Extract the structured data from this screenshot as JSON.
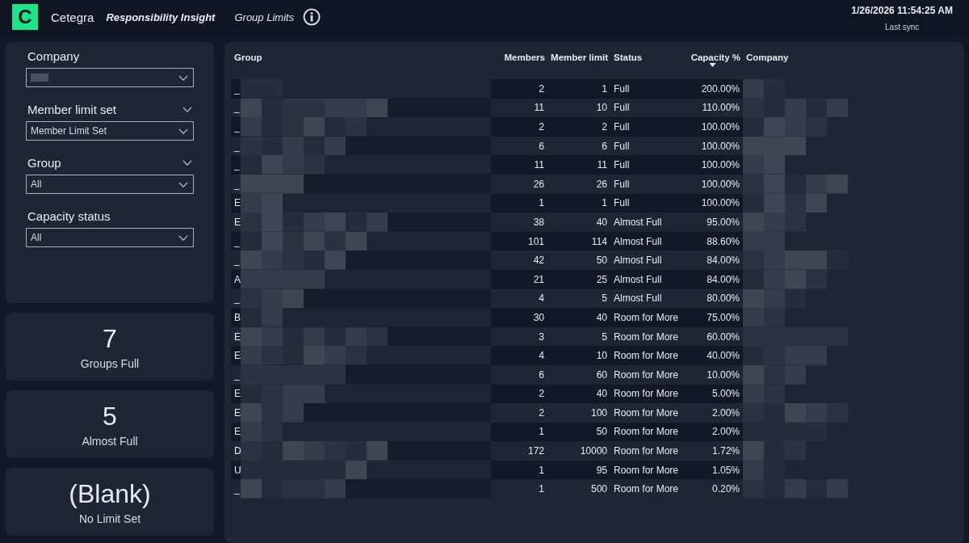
{
  "header": {
    "logo": "C",
    "brand": "Cetegra",
    "app_title": "Responsibility Insight",
    "page_title": "Group Limits",
    "sync_time": "1/26/2026 11:54:25 AM",
    "sync_label": "Last sync"
  },
  "filters": [
    {
      "label": "Company",
      "collapsible": false,
      "value_redacted": true
    },
    {
      "label": "Member limit set",
      "collapsible": true,
      "value": "Member Limit Set"
    },
    {
      "label": "Group",
      "collapsible": true,
      "value": "All"
    },
    {
      "label": "Capacity status",
      "collapsible": false,
      "value": "All"
    }
  ],
  "kpis": [
    {
      "value": "7",
      "label": "Groups Full"
    },
    {
      "value": "5",
      "label": "Almost Full"
    },
    {
      "value": "(Blank)",
      "label": "No Limit Set"
    }
  ],
  "table": {
    "columns": [
      {
        "label": "Group",
        "sorted": false
      },
      {
        "label": "Members",
        "sorted": false
      },
      {
        "label": "Member limit",
        "sorted": false
      },
      {
        "label": "Status",
        "sorted": false
      },
      {
        "label": "Capacity %",
        "sorted": true
      },
      {
        "label": "Company",
        "sorted": false
      }
    ],
    "rows": [
      {
        "group": "_",
        "members": "2",
        "limit": "1",
        "status": "Full",
        "capacity": "200.00%"
      },
      {
        "group": "_",
        "members": "11",
        "limit": "10",
        "status": "Full",
        "capacity": "110.00%"
      },
      {
        "group": "_",
        "members": "2",
        "limit": "2",
        "status": "Full",
        "capacity": "100.00%"
      },
      {
        "group": "_",
        "members": "6",
        "limit": "6",
        "status": "Full",
        "capacity": "100.00%"
      },
      {
        "group": "_",
        "members": "11",
        "limit": "11",
        "status": "Full",
        "capacity": "100.00%"
      },
      {
        "group": "_",
        "members": "26",
        "limit": "26",
        "status": "Full",
        "capacity": "100.00%"
      },
      {
        "group": "E",
        "members": "1",
        "limit": "1",
        "status": "Full",
        "capacity": "100.00%"
      },
      {
        "group": "E",
        "members": "38",
        "limit": "40",
        "status": "Almost Full",
        "capacity": "95.00%"
      },
      {
        "group": "_",
        "members": "101",
        "limit": "114",
        "status": "Almost Full",
        "capacity": "88.60%"
      },
      {
        "group": "_",
        "members": "42",
        "limit": "50",
        "status": "Almost Full",
        "capacity": "84.00%"
      },
      {
        "group": "A",
        "members": "21",
        "limit": "25",
        "status": "Almost Full",
        "capacity": "84.00%"
      },
      {
        "group": "_",
        "members": "4",
        "limit": "5",
        "status": "Almost Full",
        "capacity": "80.00%"
      },
      {
        "group": "B",
        "members": "30",
        "limit": "40",
        "status": "Room for More",
        "capacity": "75.00%"
      },
      {
        "group": "E",
        "members": "3",
        "limit": "5",
        "status": "Room for More",
        "capacity": "60.00%"
      },
      {
        "group": "E",
        "members": "4",
        "limit": "10",
        "status": "Room for More",
        "capacity": "40.00%"
      },
      {
        "group": "_",
        "members": "6",
        "limit": "60",
        "status": "Room for More",
        "capacity": "10.00%"
      },
      {
        "group": "E",
        "members": "2",
        "limit": "40",
        "status": "Room for More",
        "capacity": "5.00%"
      },
      {
        "group": "E",
        "members": "2",
        "limit": "100",
        "status": "Room for More",
        "capacity": "2.00%"
      },
      {
        "group": "E",
        "members": "1",
        "limit": "50",
        "status": "Room for More",
        "capacity": "2.00%"
      },
      {
        "group": "D",
        "members": "172",
        "limit": "10000",
        "status": "Room for More",
        "capacity": "1.72%"
      },
      {
        "group": "U",
        "members": "1",
        "limit": "95",
        "status": "Room for More",
        "capacity": "1.05%"
      },
      {
        "group": "_",
        "members": "1",
        "limit": "500",
        "status": "Room for More",
        "capacity": "0.20%"
      }
    ]
  }
}
